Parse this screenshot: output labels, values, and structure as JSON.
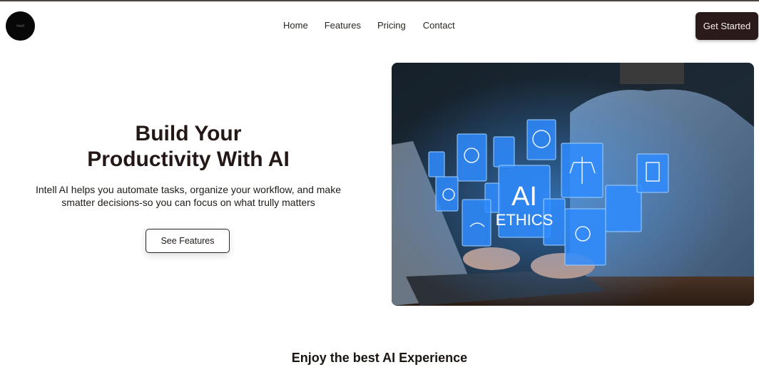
{
  "brand": {
    "logo_text": "Intell"
  },
  "nav": {
    "items": [
      {
        "label": "Home"
      },
      {
        "label": "Features"
      },
      {
        "label": "Pricing"
      },
      {
        "label": "Contact"
      }
    ],
    "cta_label": "Get Started"
  },
  "hero": {
    "title_line1": "Build Your",
    "title_line2": "Productivity With AI",
    "description_line1": "Intell AI helps you automate tasks, organize your workflow, and make",
    "description_line2": "smatter decisions-so you can focus on what trully matters",
    "button_label": "See Features",
    "image": {
      "label_line1": "AI",
      "label_line2": "ETHICS"
    }
  },
  "section": {
    "title": "Enjoy the best AI Experience"
  },
  "colors": {
    "accent_dark": "#2b1a1a",
    "hologram_blue": "#2f8cff",
    "text": "#1f1a17"
  }
}
